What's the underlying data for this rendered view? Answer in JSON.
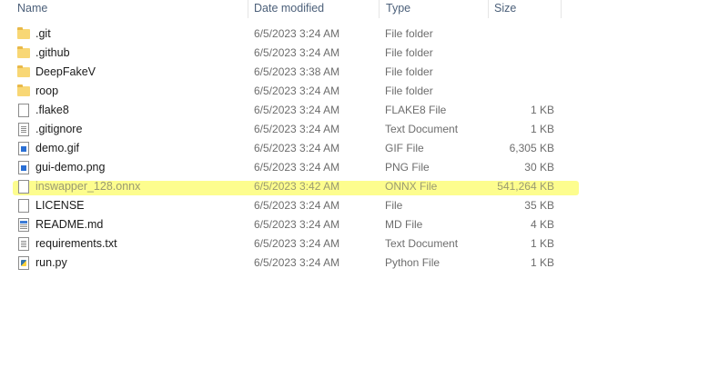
{
  "columns": {
    "name": "Name",
    "date_modified": "Date modified",
    "type": "Type",
    "size": "Size"
  },
  "files": [
    {
      "name": ".git",
      "date": "6/5/2023 3:24 AM",
      "type": "File folder",
      "size": "",
      "icon": "folder-icon"
    },
    {
      "name": ".github",
      "date": "6/5/2023 3:24 AM",
      "type": "File folder",
      "size": "",
      "icon": "folder-icon"
    },
    {
      "name": "DeepFakeV",
      "date": "6/5/2023 3:38 AM",
      "type": "File folder",
      "size": "",
      "icon": "folder-icon"
    },
    {
      "name": "roop",
      "date": "6/5/2023 3:24 AM",
      "type": "File folder",
      "size": "",
      "icon": "folder-icon"
    },
    {
      "name": ".flake8",
      "date": "6/5/2023 3:24 AM",
      "type": "FLAKE8 File",
      "size": "1 KB",
      "icon": "file-icon"
    },
    {
      "name": ".gitignore",
      "date": "6/5/2023 3:24 AM",
      "type": "Text Document",
      "size": "1 KB",
      "icon": "text-file-icon"
    },
    {
      "name": "demo.gif",
      "date": "6/5/2023 3:24 AM",
      "type": "GIF File",
      "size": "6,305 KB",
      "icon": "image-file-icon"
    },
    {
      "name": "gui-demo.png",
      "date": "6/5/2023 3:24 AM",
      "type": "PNG File",
      "size": "30 KB",
      "icon": "image-file-icon"
    },
    {
      "name": "inswapper_128.onnx",
      "date": "6/5/2023 3:42 AM",
      "type": "ONNX File",
      "size": "541,264 KB",
      "icon": "file-icon",
      "highlighted": true
    },
    {
      "name": "LICENSE",
      "date": "6/5/2023 3:24 AM",
      "type": "File",
      "size": "35 KB",
      "icon": "file-icon"
    },
    {
      "name": "README.md",
      "date": "6/5/2023 3:24 AM",
      "type": "MD File",
      "size": "4 KB",
      "icon": "markdown-file-icon"
    },
    {
      "name": "requirements.txt",
      "date": "6/5/2023 3:24 AM",
      "type": "Text Document",
      "size": "1 KB",
      "icon": "text-file-icon"
    },
    {
      "name": "run.py",
      "date": "6/5/2023 3:24 AM",
      "type": "Python File",
      "size": "1 KB",
      "icon": "python-file-icon"
    }
  ],
  "colors": {
    "highlight": "#fdfd7a",
    "header_text": "#4c607a",
    "folder": "#f8d775"
  }
}
